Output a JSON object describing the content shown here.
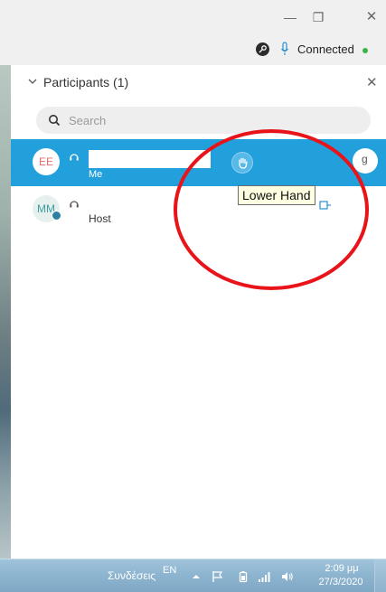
{
  "window": {
    "minimize_glyph": "—",
    "restore_glyph": "❐",
    "close_glyph": "✕"
  },
  "connection": {
    "status": "Connected",
    "status_color": "#3bb34a"
  },
  "participants_panel": {
    "title": "Participants (1)",
    "close_glyph": "✕",
    "search_placeholder": "Search",
    "selected_row_color": "#21a0db",
    "rows": [
      {
        "initials": "EE",
        "role": "Me",
        "icon": "headset-icon"
      },
      {
        "initials": "MM",
        "role": "Host",
        "icon": "headset-icon"
      }
    ],
    "right_circle_letter": "g",
    "hand_button_icon": "raised-hand-icon"
  },
  "tooltip": {
    "text": "Lower Hand"
  },
  "taskbar": {
    "connections_label": "Συνδέσεις",
    "language": "EN",
    "time": "2:09 μμ",
    "date": "27/3/2020",
    "icons": [
      "show-hidden-icon",
      "flag-icon",
      "battery-icon",
      "signal-icon",
      "volume-icon"
    ]
  }
}
